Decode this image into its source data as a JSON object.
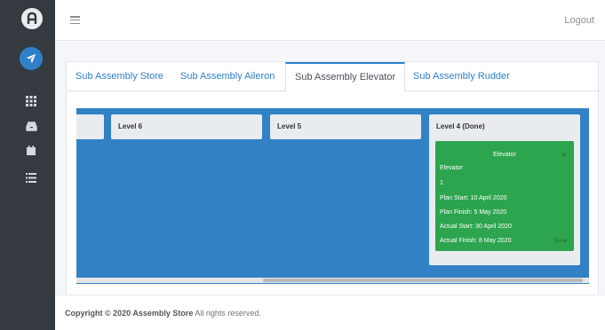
{
  "sidebar": {
    "items": [
      {
        "icon": "logo-icon"
      },
      {
        "icon": "plane-icon"
      },
      {
        "icon": "grid-icon"
      },
      {
        "icon": "inbox-icon"
      },
      {
        "icon": "calendar-icon"
      },
      {
        "icon": "list-icon"
      }
    ]
  },
  "header": {
    "logout": "Logout"
  },
  "tabs": [
    {
      "label": "Sub Assembly Store"
    },
    {
      "label": "Sub Assembly Aileron"
    },
    {
      "label": "Sub Assembly Elevator",
      "active": true
    },
    {
      "label": "Sub Assembly Rudder"
    }
  ],
  "board": {
    "columns": [
      {
        "label": "Level 6"
      },
      {
        "label": "Level 5"
      },
      {
        "label": "Level 4 (Done)"
      }
    ],
    "card": {
      "title": "Elevator",
      "name": "Elevator",
      "qty": "1",
      "plan_start": "Plan Start: 10 April 2020",
      "plan_finish": "Plan Finish: 5 May 2020",
      "actual_start": "Actual Start: 30 April 2020",
      "actual_finish": "Actual Finish: 8 May 2020",
      "status": "Done",
      "close": "×"
    }
  },
  "footer": {
    "copyright": "Copyright © 2020 Assembly Store",
    "rights": " All rights reserved."
  },
  "colors": {
    "sidebar": "#343a40",
    "accent": "#2f80c9",
    "board": "#3281c5",
    "done_card": "#2da44e"
  }
}
